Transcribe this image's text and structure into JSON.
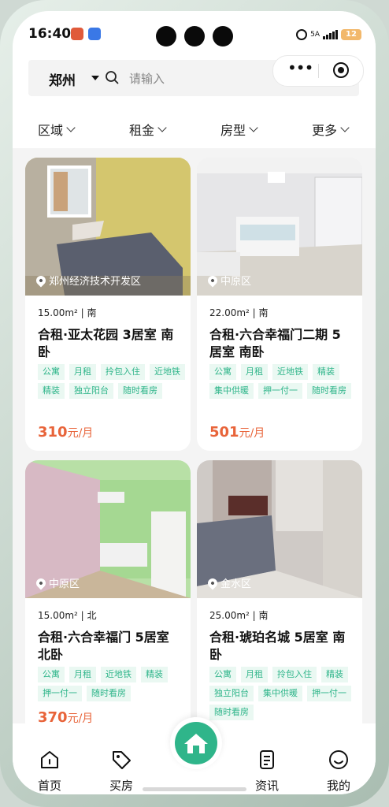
{
  "status_bar": {
    "time": "16:40",
    "network": "5A",
    "battery": "12"
  },
  "search": {
    "city": "郑州",
    "placeholder": "请输入"
  },
  "filters": [
    {
      "label": "区域"
    },
    {
      "label": "租金"
    },
    {
      "label": "房型"
    },
    {
      "label": "更多"
    }
  ],
  "listings": [
    {
      "district": "郑州经济技术开发区",
      "meta": "15.00m² | 南",
      "title": "合租·亚太花园 3居室 南卧",
      "tags": [
        "公寓",
        "月租",
        "拎包入住",
        "近地铁",
        "精装",
        "独立阳台",
        "随时看房"
      ],
      "price": "310",
      "unit": "元/月"
    },
    {
      "district": "中原区",
      "meta": "22.00m² | 南",
      "title": "合租·六合幸福门二期 5居室 南卧",
      "tags": [
        "公寓",
        "月租",
        "近地铁",
        "精装",
        "集中供暖",
        "押一付一",
        "随时看房"
      ],
      "price": "501",
      "unit": "元/月"
    },
    {
      "district": "中原区",
      "meta": "15.00m² | 北",
      "title": "合租·六合幸福门 5居室 北卧",
      "tags": [
        "公寓",
        "月租",
        "近地铁",
        "精装",
        "押一付一",
        "随时看房"
      ],
      "price": "370",
      "unit": "元/月"
    },
    {
      "district": "金水区",
      "meta": "25.00m² | 南",
      "title": "合租·琥珀名城 5居室 南卧",
      "tags": [
        "公寓",
        "月租",
        "拎包入住",
        "精装",
        "独立阳台",
        "集中供暖",
        "押一付一",
        "随时看房"
      ],
      "price": "",
      "unit": ""
    }
  ],
  "nav": [
    {
      "label": "首页",
      "icon": "home-outline-icon"
    },
    {
      "label": "买房",
      "icon": "tag-icon"
    },
    {
      "label": "",
      "icon": "house-fab-icon"
    },
    {
      "label": "资讯",
      "icon": "document-icon"
    },
    {
      "label": "我的",
      "icon": "smiley-icon"
    }
  ],
  "colors": {
    "accent": "#2fb58a",
    "price": "#e8643a",
    "tag_bg": "#eaf8f2"
  }
}
